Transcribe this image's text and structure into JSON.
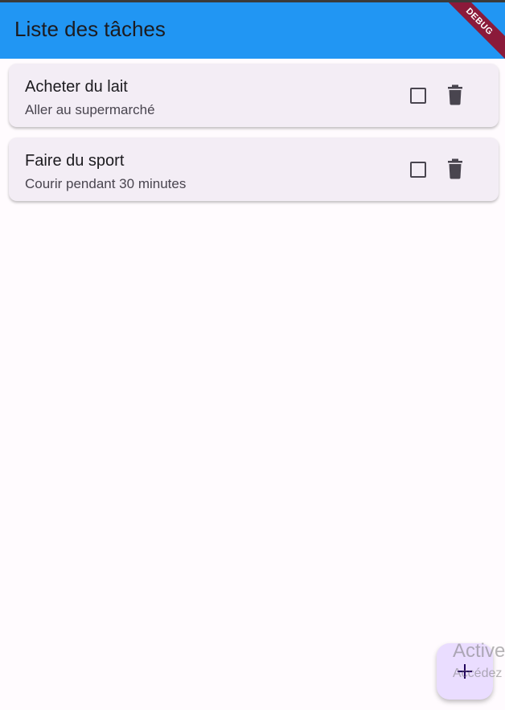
{
  "app": {
    "title": "Liste des tâches",
    "debug_label": "DEBUG"
  },
  "tasks": [
    {
      "title": "Acheter du lait",
      "subtitle": "Aller au supermarché",
      "done": false
    },
    {
      "title": "Faire du sport",
      "subtitle": "Courir pendant 30 minutes",
      "done": false
    }
  ],
  "icons": {
    "checkbox": "checkbox-unchecked-icon",
    "delete": "delete-icon",
    "add": "add-icon"
  },
  "colors": {
    "appbar": "#2196f3",
    "card": "#f3edf5",
    "fab": "#eaddff",
    "debug_banner": "#8b1a3a"
  },
  "watermark": {
    "title": "Active",
    "subtitle": "Accédez"
  }
}
